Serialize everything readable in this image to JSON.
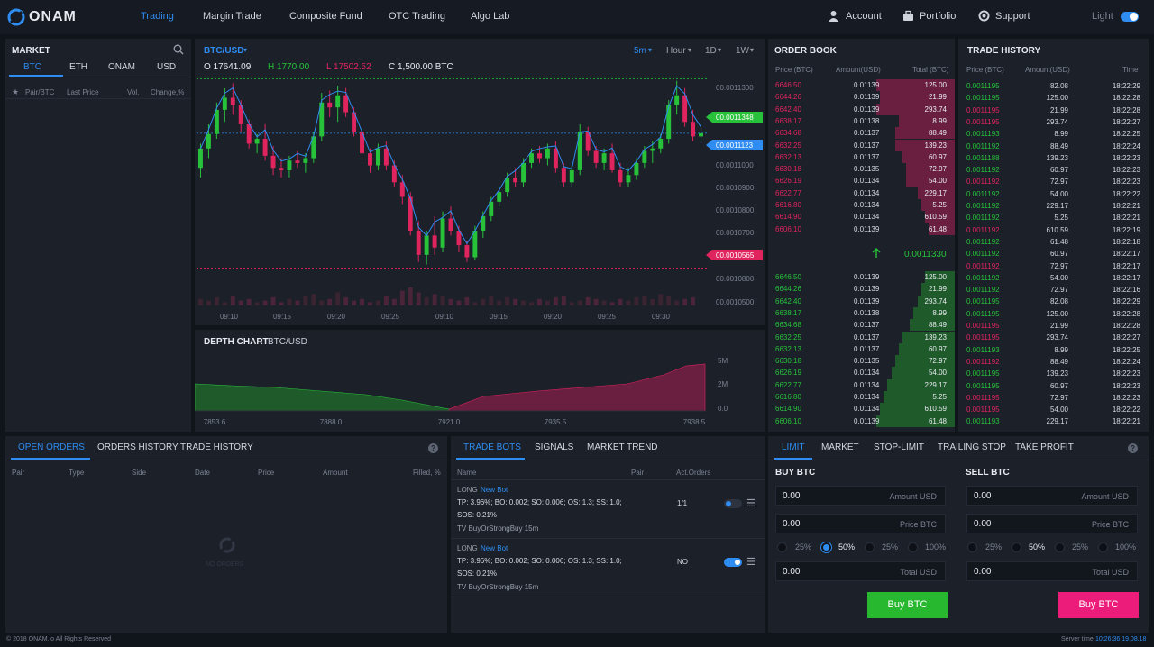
{
  "brand": {
    "name": "ONAM"
  },
  "nav": {
    "items": [
      "Trading",
      "Margin Trade",
      "Composite Fund",
      "OTC Trading",
      "Algo Lab"
    ],
    "account": "Account",
    "portfolio": "Portfolio",
    "support": "Support",
    "theme_label": "Light"
  },
  "market": {
    "title": "MARKET",
    "tabs": [
      "BTC",
      "ETH",
      "ONAM",
      "USD"
    ],
    "columns": [
      "Pair/BTC",
      "Last Price",
      "Vol.",
      "Change,%"
    ]
  },
  "chart": {
    "pair": "BTC/USD",
    "ohlc": {
      "open": "O 17641.09",
      "high": "H 1770.00",
      "low": "L 17502.52",
      "close": "C 1,500.00 BTC"
    },
    "controls": [
      "5m",
      "Hour",
      "1D",
      "1W"
    ],
    "price_axis": [
      "00.0011300",
      "00.0011348",
      "00.0011123",
      "00.0011000",
      "00.0010900",
      "00.0010800",
      "00.0010700",
      "00.0010565",
      "00.0010800",
      "00.0010500"
    ],
    "time_axis": [
      "09:10",
      "09:15",
      "09:20",
      "09:25",
      "09:10",
      "09:15",
      "09:20",
      "09:25",
      "09:30"
    ],
    "colors": {
      "up": "#28c23a",
      "down": "#e0245e",
      "line": "#2f8cf0"
    }
  },
  "chart_data": {
    "type": "candlestick",
    "candles": [
      [
        0.001098,
        0.001108,
        0.001094,
        0.001106
      ],
      [
        0.001106,
        0.001116,
        0.001102,
        0.001112
      ],
      [
        0.001112,
        0.001125,
        0.00111,
        0.001122
      ],
      [
        0.001122,
        0.001131,
        0.001117,
        0.001127
      ],
      [
        0.001127,
        0.001133,
        0.00112,
        0.001124
      ],
      [
        0.001124,
        0.001126,
        0.001113,
        0.001116
      ],
      [
        0.001116,
        0.001118,
        0.001106,
        0.001108
      ],
      [
        0.001108,
        0.001112,
        0.001104,
        0.00111
      ],
      [
        0.00111,
        0.001116,
        0.001101,
        0.001103
      ],
      [
        0.001103,
        0.001107,
        0.001095,
        0.001098
      ],
      [
        0.001098,
        0.001102,
        0.001094,
        0.001097
      ],
      [
        0.001097,
        0.001103,
        0.001094,
        0.001101
      ],
      [
        0.001101,
        0.001105,
        0.001098,
        0.0011
      ],
      [
        0.0011,
        0.001104,
        0.001096,
        0.001102
      ],
      [
        0.001102,
        0.001113,
        0.0011,
        0.001111
      ],
      [
        0.001111,
        0.001129,
        0.001109,
        0.001125
      ],
      [
        0.001125,
        0.00113,
        0.001119,
        0.001123
      ],
      [
        0.001123,
        0.001132,
        0.001117,
        0.001128
      ],
      [
        0.001128,
        0.001131,
        0.001119,
        0.001121
      ],
      [
        0.001121,
        0.001123,
        0.001111,
        0.001113
      ],
      [
        0.001113,
        0.001115,
        0.001101,
        0.001104
      ],
      [
        0.001104,
        0.001106,
        0.001096,
        0.001099
      ],
      [
        0.001099,
        0.001108,
        0.001097,
        0.001106
      ],
      [
        0.001106,
        0.001109,
        0.001097,
        0.001099
      ],
      [
        0.001099,
        0.001101,
        0.00109,
        0.001092
      ],
      [
        0.001092,
        0.001095,
        0.001083,
        0.001086
      ],
      [
        0.001086,
        0.001088,
        0.00107,
        0.001072
      ],
      [
        0.001072,
        0.001076,
        0.001059,
        0.001062
      ],
      [
        0.001062,
        0.001072,
        0.001058,
        0.00107
      ],
      [
        0.00107,
        0.001078,
        0.001062,
        0.001065
      ],
      [
        0.001065,
        0.00108,
        0.001063,
        0.001077
      ],
      [
        0.001077,
        0.001082,
        0.00107,
        0.001072
      ],
      [
        0.001072,
        0.001074,
        0.001063,
        0.001066
      ],
      [
        0.001066,
        0.001068,
        0.001059,
        0.001061
      ],
      [
        0.001061,
        0.001074,
        0.00106,
        0.001072
      ],
      [
        0.001072,
        0.00108,
        0.001069,
        0.001078
      ],
      [
        0.001078,
        0.001086,
        0.001076,
        0.001084
      ],
      [
        0.001084,
        0.00109,
        0.001082,
        0.001088
      ],
      [
        0.001088,
        0.001096,
        0.001086,
        0.001094
      ],
      [
        0.001094,
        0.001098,
        0.00109,
        0.001092
      ],
      [
        0.001092,
        0.001102,
        0.00109,
        0.0011
      ],
      [
        0.0011,
        0.001106,
        0.001098,
        0.001104
      ],
      [
        0.001104,
        0.001107,
        0.0011,
        0.001102
      ],
      [
        0.001102,
        0.001108,
        0.001099,
        0.001106
      ],
      [
        0.001106,
        0.001109,
        0.001096,
        0.001098
      ],
      [
        0.001098,
        0.0011,
        0.00109,
        0.001092
      ],
      [
        0.001092,
        0.001099,
        0.00109,
        0.001097
      ],
      [
        0.001097,
        0.001116,
        0.001095,
        0.001113
      ],
      [
        0.001113,
        0.001115,
        0.001103,
        0.001105
      ],
      [
        0.001105,
        0.001107,
        0.001098,
        0.0011
      ],
      [
        0.0011,
        0.001106,
        0.001097,
        0.001104
      ],
      [
        0.001104,
        0.001108,
        0.001096,
        0.001097
      ],
      [
        0.001097,
        0.0011,
        0.00109,
        0.001092
      ],
      [
        0.001092,
        0.001098,
        0.00109,
        0.001095
      ],
      [
        0.001095,
        0.001102,
        0.001093,
        0.0011
      ],
      [
        0.0011,
        0.001107,
        0.001098,
        0.001105
      ],
      [
        0.001105,
        0.001109,
        0.0011,
        0.001106
      ],
      [
        0.001106,
        0.001112,
        0.001104,
        0.00111
      ],
      [
        0.00111,
        0.001126,
        0.001108,
        0.001124
      ],
      [
        0.001124,
        0.001134,
        0.00112,
        0.001128
      ],
      [
        0.001128,
        0.001131,
        0.001115,
        0.001117
      ],
      [
        0.001117,
        0.001122,
        0.001109,
        0.001111
      ],
      [
        0.001111,
        0.001116,
        0.001108,
        0.0011123
      ]
    ],
    "volumes": [
      4,
      3,
      5,
      2,
      6,
      3,
      4,
      2,
      3,
      5,
      2,
      4,
      3,
      6,
      7,
      3,
      4,
      8,
      5,
      3,
      4,
      2,
      3,
      6,
      4,
      9,
      11,
      8,
      5,
      7,
      6,
      4,
      3,
      5,
      2,
      4,
      6,
      3,
      5,
      4,
      3,
      2,
      4,
      3,
      5,
      6,
      2,
      3,
      5,
      4,
      3,
      2,
      4,
      3,
      5,
      6,
      4,
      7,
      6,
      3,
      4,
      5
    ],
    "ylim": [
      0.00105,
      0.001135
    ]
  },
  "depth": {
    "title": "DEPTH CHART",
    "pair": "BTC/USD",
    "x_labels": [
      "7853.6",
      "7888.0",
      "7921.0",
      "7935.5",
      "7938.5"
    ],
    "y_labels": [
      "5M",
      "2M",
      "0.0"
    ]
  },
  "orderbook": {
    "title": "ORDER BOOK",
    "columns": [
      "Price (BTC)",
      "Amount(USD)",
      "Total (BTC)"
    ],
    "asks": [
      [
        "6646.50",
        "0.01139",
        "125.00"
      ],
      [
        "6644.26",
        "0.01139",
        "21.99"
      ],
      [
        "6642.40",
        "0.01139",
        "293.74"
      ],
      [
        "6638.17",
        "0.01138",
        "8.99"
      ],
      [
        "6634.68",
        "0.01137",
        "88.49"
      ],
      [
        "6632.25",
        "0.01137",
        "139.23"
      ],
      [
        "6632.13",
        "0.01137",
        "60.97"
      ],
      [
        "6630.18",
        "0.01135",
        "72.97"
      ],
      [
        "6626.19",
        "0.01134",
        "54.00"
      ],
      [
        "6622.77",
        "0.01134",
        "229.17"
      ],
      [
        "6616.80",
        "0.01134",
        "5.25"
      ],
      [
        "6614.90",
        "0.01134",
        "610.59"
      ],
      [
        "6606.10",
        "0.01139",
        "61.48"
      ]
    ],
    "ask_depth": [
      0.42,
      0.4,
      0.42,
      0.3,
      0.32,
      0.32,
      0.28,
      0.26,
      0.26,
      0.2,
      0.18,
      0.16,
      0.14
    ],
    "last_price": "0.0011330",
    "bids": [
      [
        "6646.50",
        "0.01139",
        "125.00"
      ],
      [
        "6644.26",
        "0.01139",
        "21.99"
      ],
      [
        "6642.40",
        "0.01139",
        "293.74"
      ],
      [
        "6638.17",
        "0.01138",
        "8.99"
      ],
      [
        "6634.68",
        "0.01137",
        "88.49"
      ],
      [
        "6632.25",
        "0.01137",
        "139.23"
      ],
      [
        "6632.13",
        "0.01137",
        "60.97"
      ],
      [
        "6630.18",
        "0.01135",
        "72.97"
      ],
      [
        "6626.19",
        "0.01134",
        "54.00"
      ],
      [
        "6622.77",
        "0.01134",
        "229.17"
      ],
      [
        "6616.80",
        "0.01134",
        "5.25"
      ],
      [
        "6614.90",
        "0.01134",
        "610.59"
      ],
      [
        "6606.10",
        "0.01139",
        "61.48"
      ]
    ],
    "bid_depth": [
      0.16,
      0.18,
      0.2,
      0.22,
      0.24,
      0.28,
      0.3,
      0.32,
      0.34,
      0.36,
      0.38,
      0.4,
      0.42
    ]
  },
  "trade_history": {
    "title": "TRADE HISTORY",
    "columns": [
      "Price (BTC)",
      "Amount(USD)",
      "Time"
    ],
    "rows": [
      [
        "0.0011195",
        "82.08",
        "18:22:29",
        "g"
      ],
      [
        "0.0011195",
        "125.00",
        "18:22:28",
        "g"
      ],
      [
        "0.0011195",
        "21.99",
        "18:22:28",
        "r"
      ],
      [
        "0.0011195",
        "293.74",
        "18:22:27",
        "r"
      ],
      [
        "0.0011193",
        "8.99",
        "18:22:25",
        "g"
      ],
      [
        "0.0011192",
        "88.49",
        "18:22:24",
        "g"
      ],
      [
        "0.0011188",
        "139.23",
        "18:22:23",
        "g"
      ],
      [
        "0.0011192",
        "60.97",
        "18:22:23",
        "g"
      ],
      [
        "0.0011192",
        "72.97",
        "18:22:23",
        "r"
      ],
      [
        "0.0011192",
        "54.00",
        "18:22:22",
        "g"
      ],
      [
        "0.0011192",
        "229.17",
        "18:22:21",
        "g"
      ],
      [
        "0.0011192",
        "5.25",
        "18:22:21",
        "g"
      ],
      [
        "0.0011192",
        "610.59",
        "18:22:19",
        "r"
      ],
      [
        "0.0011192",
        "61.48",
        "18:22:18",
        "g"
      ],
      [
        "0.0011192",
        "60.97",
        "18:22:17",
        "g"
      ],
      [
        "0.0011192",
        "72.97",
        "18:22:17",
        "r"
      ],
      [
        "0.0011192",
        "54.00",
        "18:22:17",
        "g"
      ],
      [
        "0.0011192",
        "72.97",
        "18:22:16",
        "g"
      ],
      [
        "0.0011195",
        "82.08",
        "18:22:29",
        "g"
      ],
      [
        "0.0011195",
        "125.00",
        "18:22:28",
        "g"
      ],
      [
        "0.0011195",
        "21.99",
        "18:22:28",
        "r"
      ],
      [
        "0.0011195",
        "293.74",
        "18:22:27",
        "r"
      ],
      [
        "0.0011193",
        "8.99",
        "18:22:25",
        "g"
      ],
      [
        "0.0011192",
        "88.49",
        "18:22:24",
        "r"
      ],
      [
        "0.0011195",
        "139.23",
        "18:22:23",
        "g"
      ],
      [
        "0.0011195",
        "60.97",
        "18:22:23",
        "g"
      ],
      [
        "0.0011195",
        "72.97",
        "18:22:23",
        "r"
      ],
      [
        "0.0011195",
        "54.00",
        "18:22:22",
        "r"
      ],
      [
        "0.0011193",
        "229.17",
        "18:22:21",
        "g"
      ]
    ]
  },
  "orders": {
    "tabs": [
      "OPEN ORDERS",
      "ORDERS HISTORY",
      "TRADE HISTORY"
    ],
    "columns": [
      "Pair",
      "Type",
      "Side",
      "Date",
      "Price",
      "Amount",
      "Filled, %"
    ],
    "empty_text": "NO ORDERS"
  },
  "bots": {
    "tabs": [
      "TRADE BOTS",
      "SIGNALS",
      "MARKET TREND"
    ],
    "columns": [
      "Name",
      "Pair",
      "Act.Orders"
    ],
    "items": [
      {
        "side": "LONG",
        "badge": "New Bot",
        "line1": "TP: 3.96%; BO: 0.002; SO: 0.006; OS: 1.3; SS: 1.0;",
        "line2": "SOS: 0.21%",
        "strategy": "TV BuyOrStrongBuy 15m",
        "orders": "1/1",
        "enabled": false
      },
      {
        "side": "LONG",
        "badge": "New Bot",
        "line1": "TP: 3.96%; BO: 0.002; SO: 0.006; OS: 1.3; SS: 1.0;",
        "line2": "SOS: 0.21%",
        "strategy": "TV BuyOrStrongBuy 15m",
        "orders": "NO",
        "enabled": true
      }
    ]
  },
  "trade_form": {
    "tabs": [
      "LIMIT",
      "MARKET",
      "STOP-LIMIT",
      "TRAILING STOP",
      "TAKE PROFIT"
    ],
    "buy": {
      "title": "BUY BTC",
      "amount": "0.00",
      "amount_ph": "Amount USD",
      "price": "0.00",
      "price_ph": "Price BTC",
      "total": "0.00",
      "total_ph": "Total USD",
      "button": "Buy BTC",
      "color": "#28c23a"
    },
    "sell": {
      "title": "SELL BTC",
      "amount": "0.00",
      "amount_ph": "Amount USD",
      "price": "0.00",
      "price_ph": "Price BTC",
      "total": "0.00",
      "total_ph": "Total USD",
      "button": "Buy BTC",
      "color": "#ec1c7a"
    },
    "percents": [
      "25%",
      "50%",
      "25%",
      "100%"
    ],
    "selected_percent_index": 1
  },
  "footer": {
    "copyright": "© 2018 ONAM.io All Rights Reserved",
    "server_label": "Server time",
    "server_time": "10:26:36 19.08.18"
  }
}
